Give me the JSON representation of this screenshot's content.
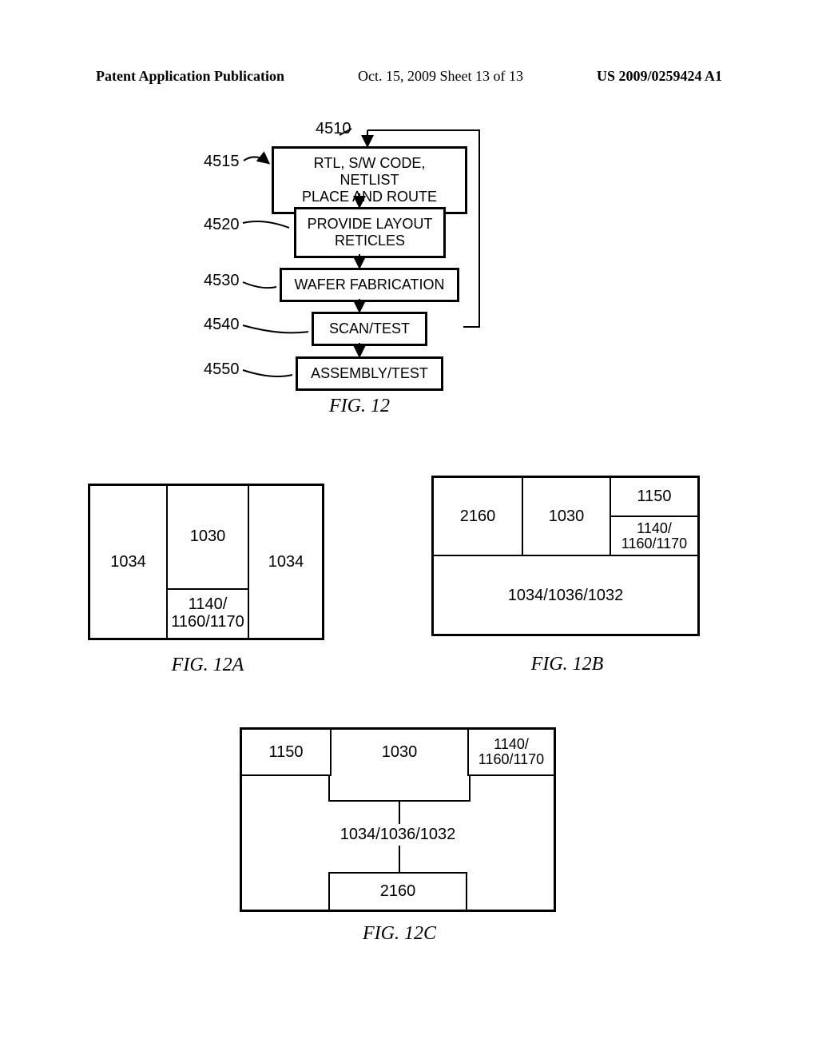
{
  "header": {
    "left": "Patent Application Publication",
    "middle": "Oct. 15, 2009  Sheet 13 of 13",
    "right": "US 2009/0259424 A1"
  },
  "fig12": {
    "ref4510": "4510",
    "ref4515": "4515",
    "ref4520": "4520",
    "ref4530": "4530",
    "ref4540": "4540",
    "ref4550": "4550",
    "box4515_l1": "RTL, S/W CODE, NETLIST",
    "box4515_l2": "PLACE AND ROUTE",
    "box4520_l1": "PROVIDE LAYOUT",
    "box4520_l2": "RETICLES",
    "box4530": "WAFER FABRICATION",
    "box4540": "SCAN/TEST",
    "box4550": "ASSEMBLY/TEST",
    "caption": "FIG. 12"
  },
  "fig12a": {
    "v1034L": "1034",
    "v1030": "1030",
    "v1034R": "1034",
    "v1140_l1": "1140/",
    "v1140_l2": "1160/1170",
    "caption": "FIG. 12A"
  },
  "fig12b": {
    "v2160": "2160",
    "v1030": "1030",
    "v1150": "1150",
    "v1140_l1": "1140/",
    "v1140_l2": "1160/1170",
    "bottom": "1034/1036/1032",
    "caption": "FIG. 12B"
  },
  "fig12c": {
    "v1150": "1150",
    "v1030": "1030",
    "v1140_l1": "1140/",
    "v1140_l2": "1160/1170",
    "mid": "1034/1036/1032",
    "v2160": "2160",
    "caption": "FIG. 12C"
  }
}
